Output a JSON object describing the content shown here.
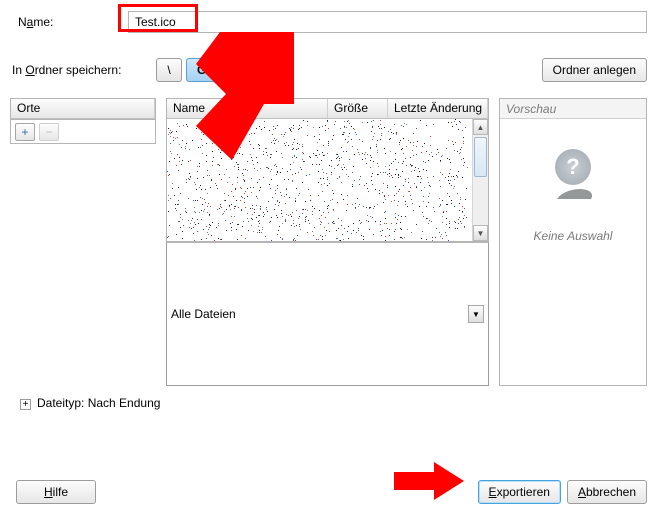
{
  "name": {
    "label_pre": "N",
    "label_u": "a",
    "label_post": "me:",
    "value": "Test.ico"
  },
  "folder": {
    "label_pre": "In ",
    "label_u": "O",
    "label_post": "rdner speichern:",
    "seg1": "\\",
    "seg2": "GIGA",
    "create_btn": "Ordner anlegen"
  },
  "places": {
    "header": "Orte",
    "add_tip": "+",
    "remove_tip": "−"
  },
  "files": {
    "h_name": "Name",
    "h_size": "Größe",
    "h_date": "Letzte Änderung",
    "sort": "▲"
  },
  "preview": {
    "header": "Vorschau",
    "icon": "?",
    "none": "Keine Auswahl"
  },
  "filter": {
    "value": "Alle Dateien"
  },
  "filetype": {
    "exp": "+",
    "label": "Dateityp: Nach Endung"
  },
  "buttons": {
    "help_u": "H",
    "help_post": "ilfe",
    "export_u": "E",
    "export_post": "xportieren",
    "cancel_u": "A",
    "cancel_post": "bbrechen"
  }
}
